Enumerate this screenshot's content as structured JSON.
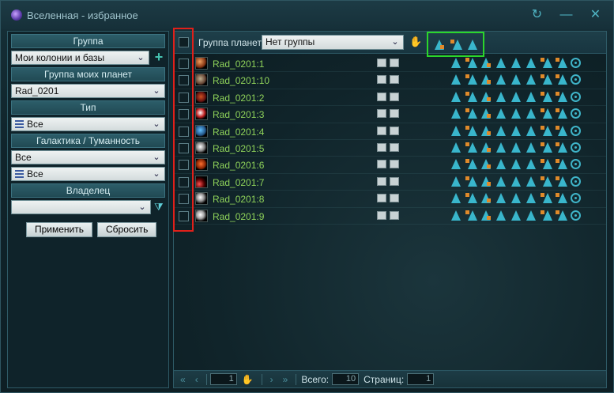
{
  "window": {
    "title": "Вселенная - избранное"
  },
  "filters": {
    "group_header": "Группа",
    "group_value": "Мои колонии и базы",
    "my_planets_header": "Группа моих планет",
    "my_planets_value": "Rad_0201",
    "type_header": "Тип",
    "type_value": "Все",
    "galaxy_header": "Галактика / Туманность",
    "galaxy_value": "Все",
    "nebula_value": "Все",
    "owner_header": "Владелец",
    "owner_value": "",
    "apply_label": "Применить",
    "reset_label": "Сбросить"
  },
  "toolbar": {
    "group_label": "Группа планет:",
    "group_value": "Нет группы"
  },
  "planets": [
    {
      "name": "Rad_0201:1"
    },
    {
      "name": "Rad_0201:10"
    },
    {
      "name": "Rad_0201:2"
    },
    {
      "name": "Rad_0201:3"
    },
    {
      "name": "Rad_0201:4"
    },
    {
      "name": "Rad_0201:5"
    },
    {
      "name": "Rad_0201:6"
    },
    {
      "name": "Rad_0201:7"
    },
    {
      "name": "Rad_0201:8"
    },
    {
      "name": "Rad_0201:9"
    }
  ],
  "pager": {
    "page": "1",
    "total_label": "Всего:",
    "total_value": "10",
    "pages_label": "Страниц:",
    "pages_value": "1"
  },
  "colors": {
    "accent": "#39b6cc",
    "planet_name": "#8fd35a",
    "highlight_red": "#e0201a",
    "highlight_green": "#2bd62b"
  },
  "icons": {
    "title": "galaxy-icon",
    "refresh": "refresh-icon",
    "close": "close-icon",
    "add": "plus-icon",
    "filter_clear": "filter-clear-icon",
    "hand": "hand-icon"
  }
}
